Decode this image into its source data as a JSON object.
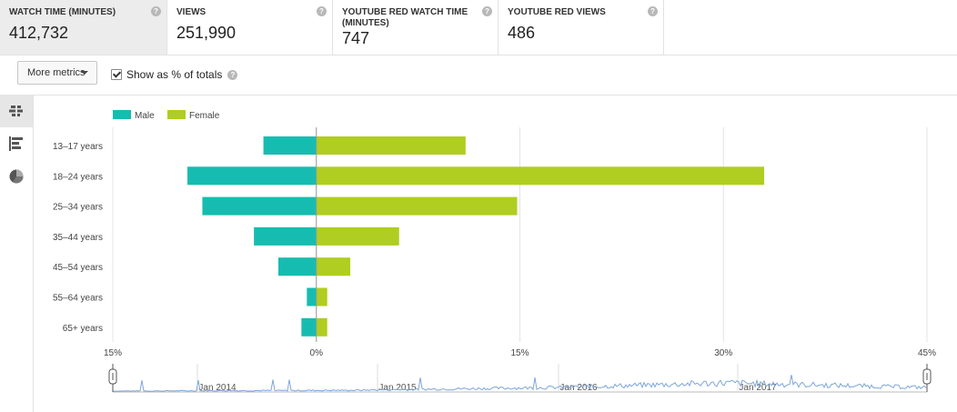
{
  "metrics": [
    {
      "label": "WATCH TIME (MINUTES)",
      "value": "412,732",
      "selected": true
    },
    {
      "label": "VIEWS",
      "value": "251,990",
      "selected": false
    },
    {
      "label": "YOUTUBE RED WATCH TIME (MINUTES)",
      "value": "747",
      "selected": false
    },
    {
      "label": "YOUTUBE RED VIEWS",
      "value": "486",
      "selected": false
    }
  ],
  "toolbar": {
    "more_metrics_label": "More metrics",
    "show_totals_label": "Show as % of totals",
    "show_totals_checked": true
  },
  "side_tabs": [
    {
      "icon": "butterfly-chart-icon",
      "active": true
    },
    {
      "icon": "bar-chart-icon",
      "active": false
    },
    {
      "icon": "pie-chart-icon",
      "active": false
    }
  ],
  "chart_data": {
    "type": "bar",
    "orientation": "horizontal-butterfly",
    "categories": [
      "13–17 years",
      "18–24 years",
      "25–34 years",
      "35–44 years",
      "45–54 years",
      "55–64 years",
      "65+ years"
    ],
    "series": [
      {
        "name": "Male",
        "color": "#17bcb0",
        "values": [
          3.9,
          9.5,
          8.4,
          4.6,
          2.8,
          0.7,
          1.1
        ]
      },
      {
        "name": "Female",
        "color": "#b0cd21",
        "values": [
          11.0,
          33.0,
          14.8,
          6.1,
          2.5,
          0.8,
          0.8
        ]
      }
    ],
    "x_ticks": [
      "15%",
      "0%",
      "15%",
      "30%",
      "45%"
    ],
    "xlim": [
      -15,
      45
    ],
    "legend": "top-left",
    "grid": true,
    "timeline": {
      "labels": [
        "Jan 2014",
        "Jan 2015",
        "Jan 2016",
        "Jan 2017"
      ],
      "color": "#7ea6d8"
    }
  }
}
